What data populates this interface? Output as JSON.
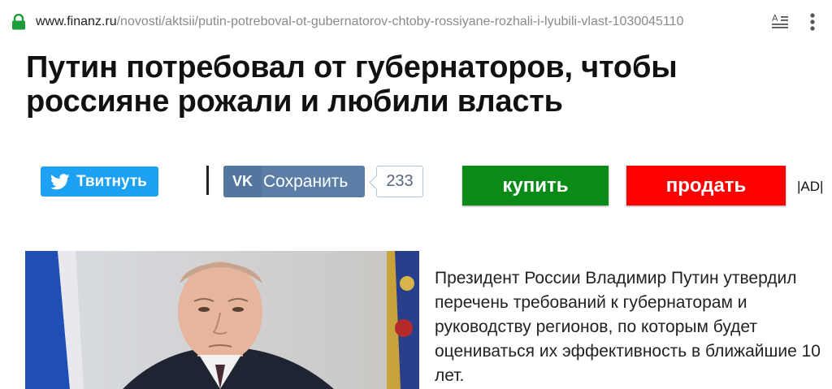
{
  "browser": {
    "url_host": "www.finanz.ru",
    "url_path": "/novosti/aktsii/putin-potreboval-ot-gubernatorov-chtoby-rossiyane-rozhali-i-lyubili-vlast-1030045110",
    "icons": [
      "lock-icon",
      "reader-mode-icon",
      "more-vert-icon"
    ]
  },
  "article": {
    "title": "Путин потребовал от губернаторов, чтобы россияне рожали и любили власть",
    "lead": "Президент России Владимир Путин утвердил перечень требований к губернаторам и руководству регионов, по которым будет оцениваться их эффективность в ближайшие 10 лет."
  },
  "share": {
    "twitter_label": "Твитнуть",
    "vk_icon_text": "VK",
    "vk_label": "Сохранить",
    "vk_count": "233"
  },
  "actions": {
    "buy_label": "купить",
    "sell_label": "продать",
    "ad_label": "|AD|"
  },
  "colors": {
    "twitter": "#1da1f2",
    "vk": "#5b7ea6",
    "buy": "#0a8a16",
    "sell": "#ff0000"
  }
}
